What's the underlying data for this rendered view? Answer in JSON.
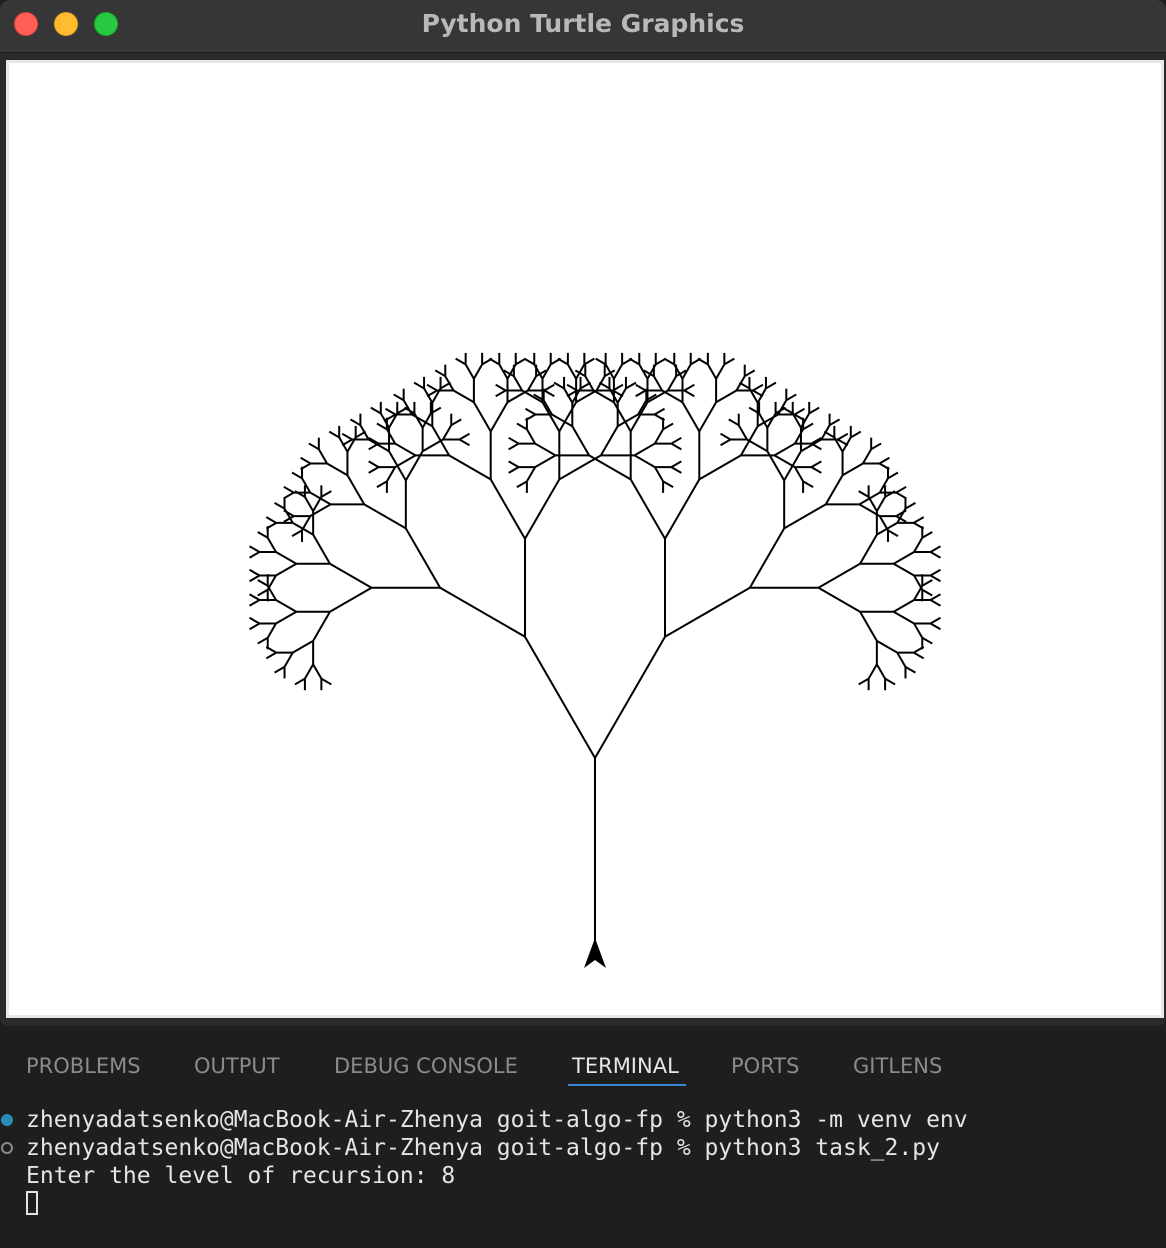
{
  "window": {
    "title": "Python Turtle Graphics",
    "controls": [
      "close-icon",
      "minimize-icon",
      "zoom-icon"
    ]
  },
  "canvas": {
    "drawing": "fractal-tree",
    "recursion_level": 8,
    "stroke_color": "#000000",
    "background": "#ffffff",
    "turtle_icon": "turtle-arrow-icon"
  },
  "panel": {
    "tabs": [
      {
        "label": "PROBLEMS"
      },
      {
        "label": "OUTPUT"
      },
      {
        "label": "DEBUG CONSOLE"
      },
      {
        "label": "TERMINAL",
        "active": true
      },
      {
        "label": "PORTS"
      },
      {
        "label": "GITLENS"
      }
    ],
    "active_tab": "TERMINAL"
  },
  "terminal": {
    "lines": [
      "zhenyadatsenko@MacBook-Air-Zhenya goit-algo-fp % python3 -m venv env",
      "zhenyadatsenko@MacBook-Air-Zhenya goit-algo-fp % python3 task_2.py",
      "Enter the level of recursion: 8"
    ]
  },
  "colors": {
    "accent": "#3d86d6",
    "close": "#fe5f57",
    "minimize": "#febc2e",
    "zoom": "#28c840"
  }
}
